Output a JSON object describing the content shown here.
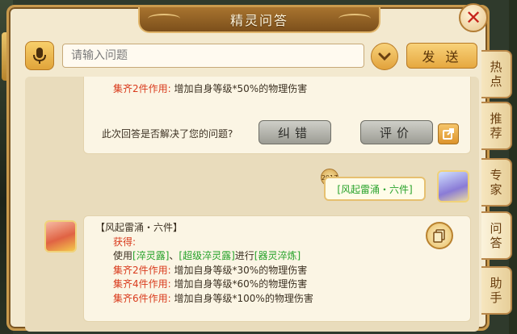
{
  "window": {
    "title": "精灵问答",
    "close_glyph": "✕"
  },
  "input_bar": {
    "placeholder": "请输入问题",
    "send_label": "发 送"
  },
  "previous_answer": {
    "set_label": "集齐2件作用:",
    "set_effect": "增加自身等级*50%的物理伤害",
    "feedback_question": "此次回答是否解决了您的问题?",
    "fix_label": "纠错",
    "rate_label": "评价"
  },
  "user_message": {
    "badge": "2017",
    "text": "[风起雷涌・六件]"
  },
  "bot_reply": {
    "title": "【风起雷涌・六件】",
    "obtain_label": "获得:",
    "use_prefix": "使用",
    "item1": "[淬灵露]",
    "sep": "、",
    "item2": "[超级淬灵露]",
    "use_mid": "进行",
    "item3": "[器灵淬炼]",
    "set2_label": "集齐2件作用:",
    "set2_effect": "增加自身等级*30%的物理伤害",
    "set4_label": "集齐4件作用:",
    "set4_effect": "增加自身等级*60%的物理伤害",
    "set6_label": "集齐6件作用:",
    "set6_effect": "增加自身等级*100%的物理伤害"
  },
  "tabs": [
    {
      "label_top": "热",
      "label_bottom": "点"
    },
    {
      "label_top": "推",
      "label_bottom": "荐"
    },
    {
      "label_top": "专",
      "label_bottom": "家"
    },
    {
      "label_top": "问",
      "label_bottom": "答"
    },
    {
      "label_top": "助",
      "label_bottom": "手"
    }
  ],
  "colors": {
    "highlight_red": "#d93a1c",
    "highlight_green": "#26a22a",
    "panel_bg": "#f3e9cf"
  },
  "icons": [
    "microphone-icon",
    "chevron-down-icon",
    "share-icon",
    "copy-icon",
    "close-icon"
  ]
}
